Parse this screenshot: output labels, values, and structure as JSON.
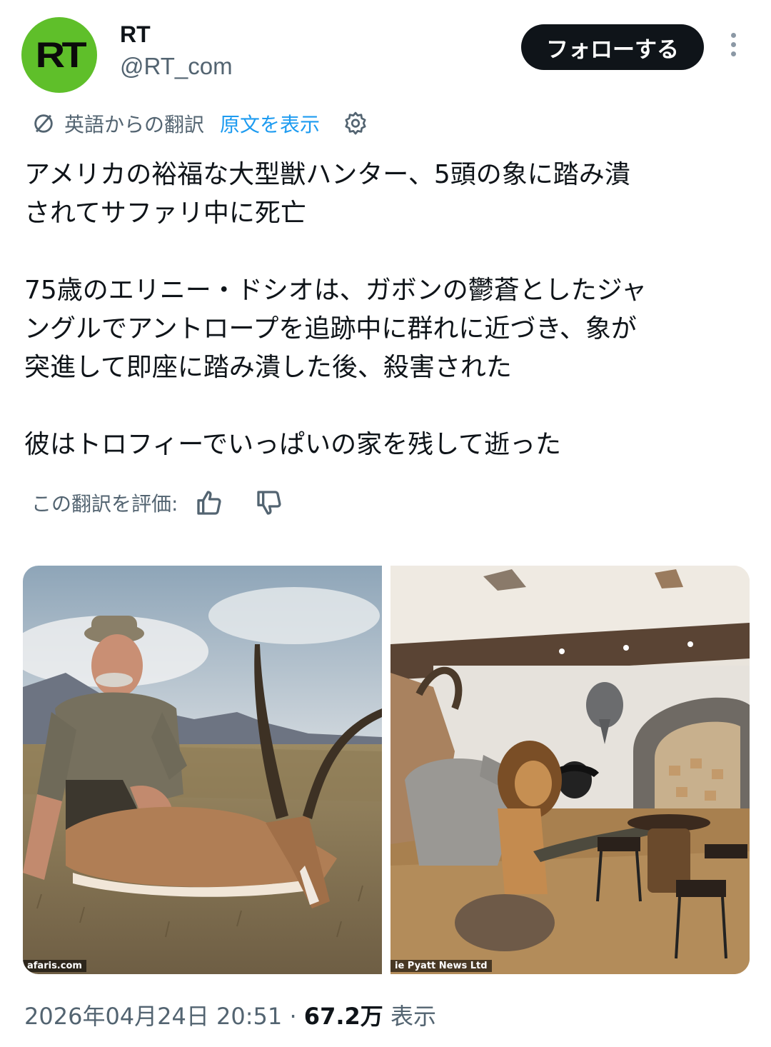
{
  "author": {
    "avatar_text": "RT",
    "name": "RT",
    "handle": "@RT_com",
    "brand_color": "#5fbf2a"
  },
  "follow_label": "フォローする",
  "more_icon": "more-vertical-icon",
  "translation": {
    "label": "英語からの翻訳",
    "show_original": "原文を表示",
    "icon": "translate-icon",
    "settings_icon": "gear-icon"
  },
  "body_text": "アメリカの裕福な大型獣ハンター、5頭の象に踏み潰\nされてサファリ中に死亡\n\n75歳のエリニー・ドシオは、ガボンの鬱蒼としたジャ\nングルでアントロープを追跡中に群れに近づき、象が\n突進して即座に踏み潰した後、殺害された\n\n彼はトロフィーでいっぱいの家を残して逝った",
  "rate": {
    "label": "この翻訳を評価:",
    "up_icon": "thumbs-up-icon",
    "down_icon": "thumbs-down-icon"
  },
  "images": [
    {
      "credit": "afaris.com"
    },
    {
      "credit": "ie Pyatt News Ltd"
    }
  ],
  "footer": {
    "timestamp": "2026年04月24日 20:51",
    "separator": "·",
    "views": "67.2万",
    "views_label": "表示"
  },
  "link_color": "#1d9bf0"
}
